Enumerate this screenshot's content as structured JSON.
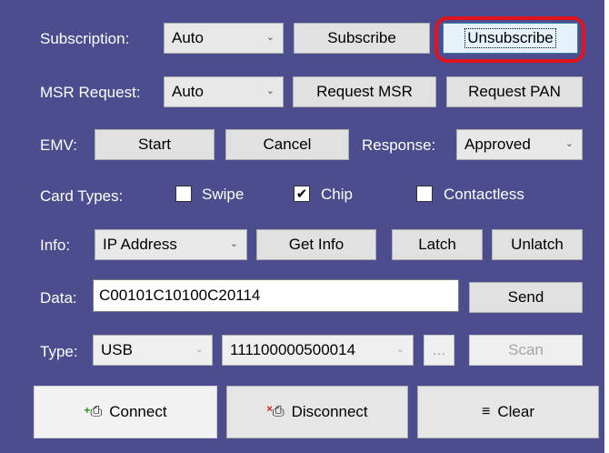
{
  "subscription": {
    "label": "Subscription:",
    "value": "Auto",
    "subscribe_label": "Subscribe",
    "unsubscribe_label": "Unsubscribe"
  },
  "msr": {
    "label": "MSR Request:",
    "value": "Auto",
    "request_msr_label": "Request MSR",
    "request_pan_label": "Request PAN"
  },
  "emv": {
    "label": "EMV:",
    "start_label": "Start",
    "cancel_label": "Cancel",
    "response_label": "Response:",
    "response_value": "Approved"
  },
  "card_types": {
    "label": "Card Types:",
    "options": [
      {
        "label": "Swipe",
        "checked": false
      },
      {
        "label": "Chip",
        "checked": true
      },
      {
        "label": "Contactless",
        "checked": false
      }
    ]
  },
  "info": {
    "label": "Info:",
    "value": "IP Address",
    "get_info_label": "Get Info",
    "latch_label": "Latch",
    "unlatch_label": "Unlatch"
  },
  "data": {
    "label": "Data:",
    "value": "C00101C10100C20114",
    "send_label": "Send"
  },
  "type": {
    "label": "Type:",
    "value": "USB",
    "device_value": "111100000500014",
    "browse_label": "...",
    "scan_label": "Scan"
  },
  "actions": {
    "connect_label": "Connect",
    "disconnect_label": "Disconnect",
    "clear_label": "Clear"
  },
  "colors": {
    "panel": "#4b4d8f",
    "highlight": "#e0141e",
    "checkmark": "#000000"
  },
  "icons": {
    "connect": "plug-plus-icon",
    "disconnect": "plug-x-icon",
    "clear": "clear-list-icon"
  }
}
